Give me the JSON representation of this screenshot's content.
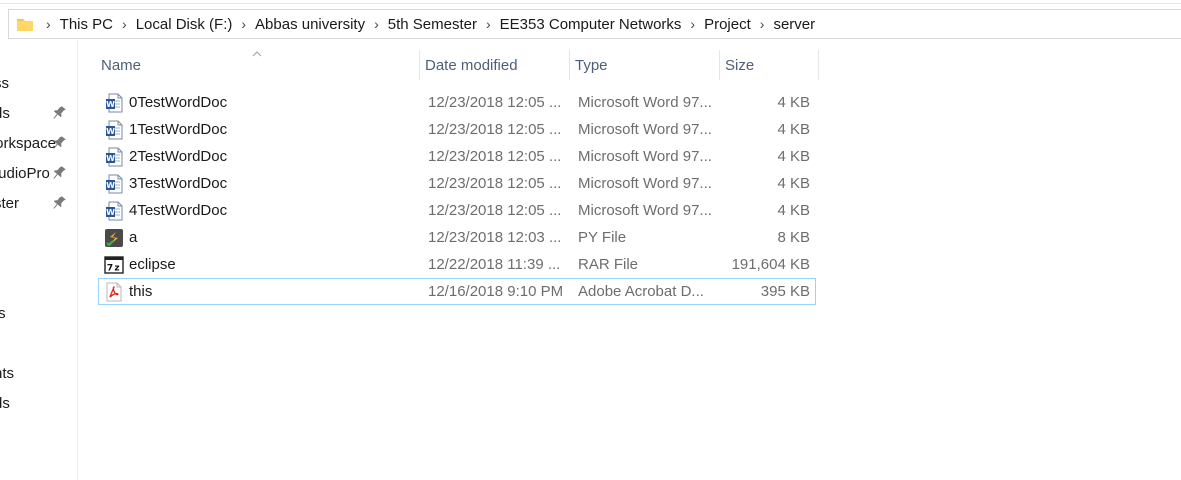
{
  "breadcrumb": [
    "This PC",
    "Local Disk (F:)",
    "Abbas university",
    "5th Semester",
    "EE353 Computer Networks",
    "Project",
    "server"
  ],
  "nav": {
    "items": [
      {
        "label": "ss",
        "pinned": false
      },
      {
        "label": "ds",
        "pinned": true
      },
      {
        "label": "workspace",
        "pinned": true
      },
      {
        "label": "tudioPro",
        "pinned": true
      },
      {
        "label": "ster",
        "pinned": true
      },
      {
        "label": "ts",
        "pinned": false
      },
      {
        "label": "nts",
        "pinned": false
      },
      {
        "label": "ds",
        "pinned": false
      }
    ]
  },
  "columns": {
    "name": "Name",
    "date": "Date modified",
    "type": "Type",
    "size": "Size"
  },
  "files": [
    {
      "name": "0TestWordDoc",
      "date": "12/23/2018 12:05 ...",
      "type": "Microsoft Word 97...",
      "size": "4 KB",
      "icon": "word-doc-icon"
    },
    {
      "name": "1TestWordDoc",
      "date": "12/23/2018 12:05 ...",
      "type": "Microsoft Word 97...",
      "size": "4 KB",
      "icon": "word-doc-icon"
    },
    {
      "name": "2TestWordDoc",
      "date": "12/23/2018 12:05 ...",
      "type": "Microsoft Word 97...",
      "size": "4 KB",
      "icon": "word-doc-icon"
    },
    {
      "name": "3TestWordDoc",
      "date": "12/23/2018 12:05 ...",
      "type": "Microsoft Word 97...",
      "size": "4 KB",
      "icon": "word-doc-icon"
    },
    {
      "name": "4TestWordDoc",
      "date": "12/23/2018 12:05 ...",
      "type": "Microsoft Word 97...",
      "size": "4 KB",
      "icon": "word-doc-icon"
    },
    {
      "name": "a",
      "date": "12/23/2018 12:03 ...",
      "type": "PY File",
      "size": "8 KB",
      "icon": "python-file-icon"
    },
    {
      "name": "eclipse",
      "date": "12/22/2018 11:39 ...",
      "type": "RAR File",
      "size": "191,604 KB",
      "icon": "archive-file-icon"
    },
    {
      "name": "this",
      "date": "12/16/2018 9:10 PM",
      "type": "Adobe Acrobat D...",
      "size": "395 KB",
      "icon": "pdf-file-icon"
    }
  ],
  "colors": {
    "header_text": "#4c607a",
    "focus_border": "#99d1ff",
    "meta_text": "#6d6d6d"
  }
}
